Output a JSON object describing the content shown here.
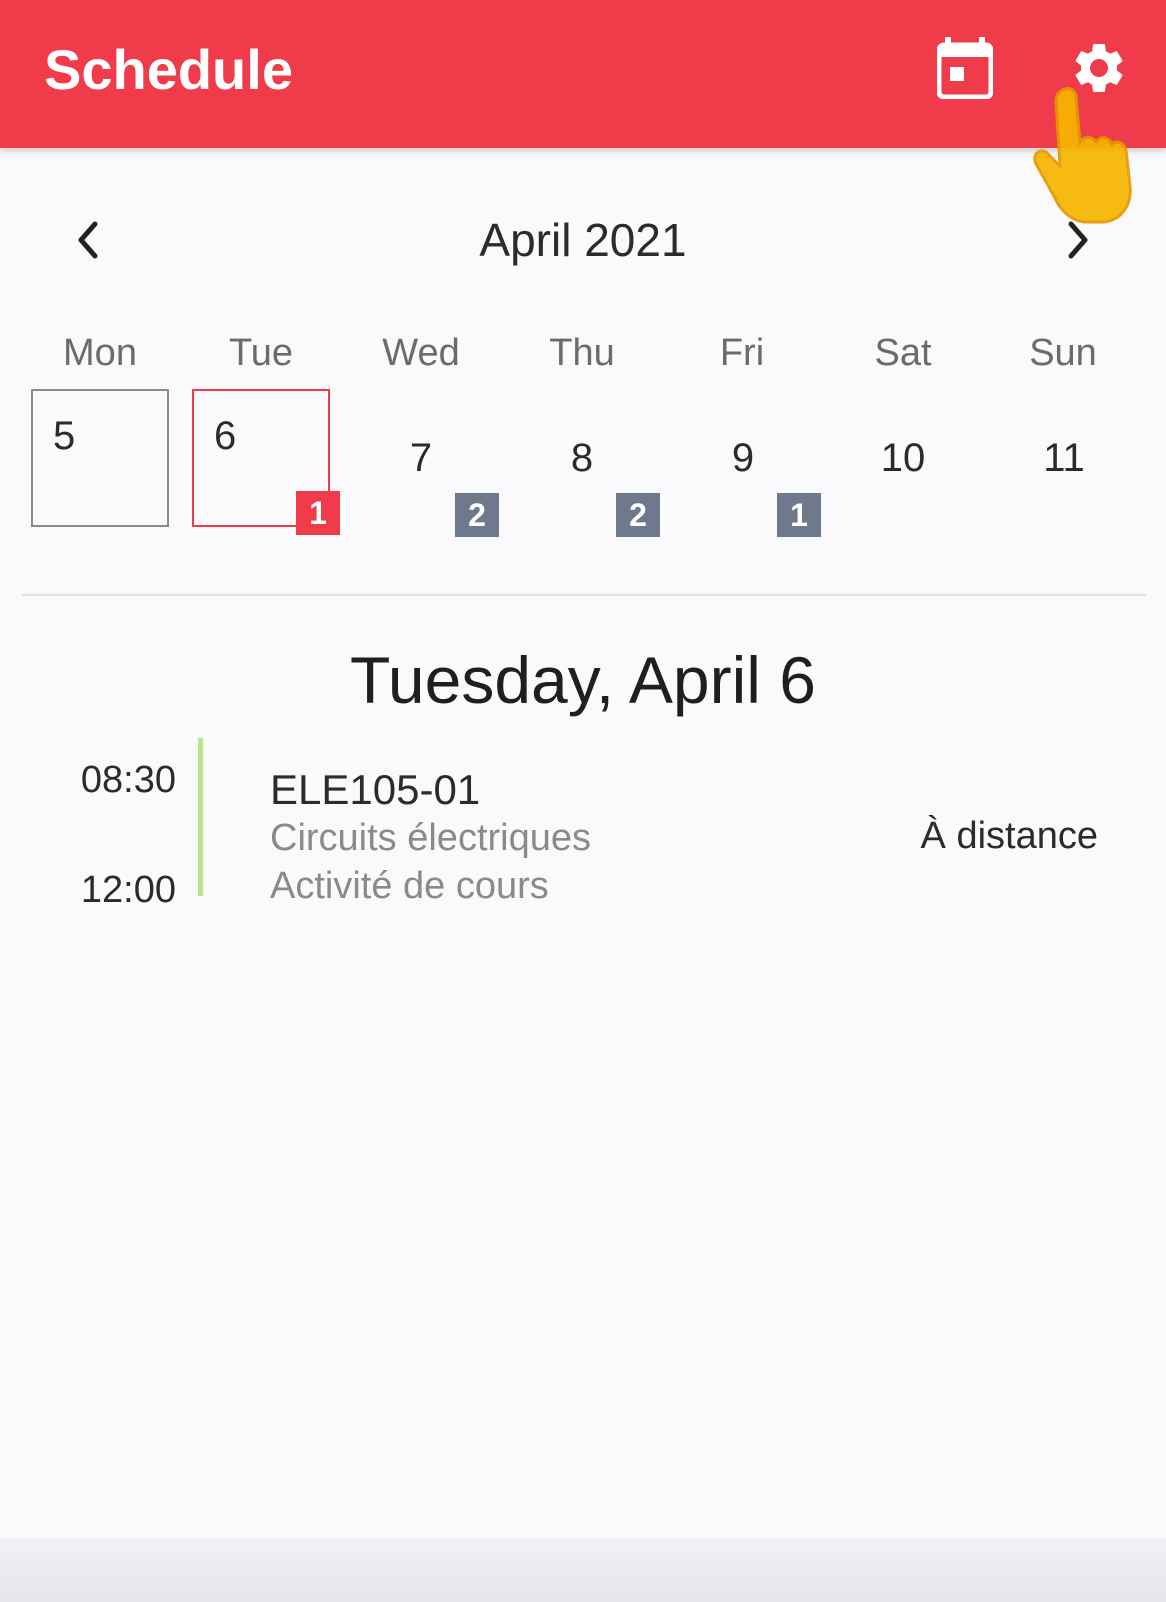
{
  "appbar": {
    "title": "Schedule",
    "color": "#ef3b4a",
    "actions": [
      {
        "icon": "calendar-today-icon"
      },
      {
        "icon": "gear-icon"
      }
    ]
  },
  "calendar": {
    "month_label": "April 2021",
    "prev_icon": "chevron-left-icon",
    "next_icon": "chevron-right-icon",
    "weekdays": [
      "Mon",
      "Tue",
      "Wed",
      "Thu",
      "Fri",
      "Sat",
      "Sun"
    ],
    "days": [
      {
        "num": "5",
        "state": "today",
        "badge": ""
      },
      {
        "num": "6",
        "state": "selected",
        "badge": "1",
        "badge_color": "#ef3b4a"
      },
      {
        "num": "7",
        "state": "normal",
        "badge": "2",
        "badge_color": "#6e7a8c"
      },
      {
        "num": "8",
        "state": "normal",
        "badge": "2",
        "badge_color": "#6e7a8c"
      },
      {
        "num": "9",
        "state": "normal",
        "badge": "1",
        "badge_color": "#6e7a8c"
      },
      {
        "num": "10",
        "state": "normal",
        "badge": ""
      },
      {
        "num": "11",
        "state": "normal",
        "badge": ""
      }
    ]
  },
  "selected_day": {
    "title": "Tuesday, April 6",
    "events": [
      {
        "start": "08:30",
        "end": "12:00",
        "code": "ELE105-01",
        "course": "Circuits électriques",
        "activity": "Activité de cours",
        "location": "À distance",
        "accent": "#b9e68a"
      }
    ]
  }
}
